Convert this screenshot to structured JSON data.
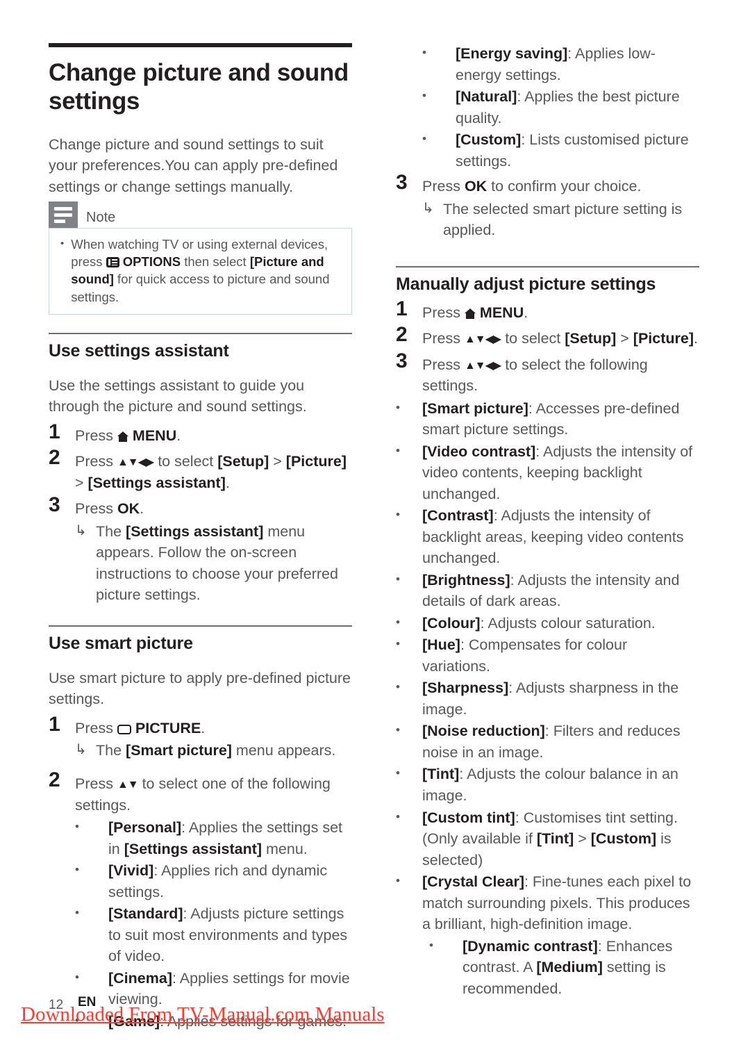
{
  "document": {
    "title": "Change picture and sound settings",
    "intro": "Change picture and sound settings to suit your preferences.You can apply pre-defined settings or change settings manually."
  },
  "note": {
    "label": "Note",
    "icon": "note-lines-icon",
    "bullet_char": "•",
    "items": [
      {
        "pre": "When watching TV or using external devices, press ",
        "icon": "options-icon",
        "key": "OPTIONS",
        "mid": " then select ",
        "bold": "[Picture and sound]",
        "post": " for quick access to picture and sound settings."
      }
    ]
  },
  "sections": {
    "settings_assistant": {
      "heading": "Use settings assistant",
      "intro": "Use the settings assistant to guide you through the picture and sound settings.",
      "steps": [
        {
          "num": "1",
          "pre": "Press ",
          "icon": "home-icon",
          "key": "MENU",
          "post": "."
        },
        {
          "num": "2",
          "pre": "Press ",
          "arrows": "▲▼◀▶",
          "mid": " to select ",
          "bold1": "[Setup]",
          "sep": " > ",
          "bold2": "[Picture]",
          "sep2": " > ",
          "bold3": "[Settings assistant]",
          "post": "."
        },
        {
          "num": "3",
          "pre": "Press ",
          "key": "OK",
          "post": "."
        }
      ],
      "result": {
        "arrow": "↳",
        "pre": "The ",
        "bold": "[Settings assistant]",
        "post": " menu appears. Follow the on-screen instructions to choose your preferred picture settings."
      }
    },
    "smart_picture": {
      "heading": "Use smart picture",
      "intro": "Use smart picture to apply pre-defined picture settings.",
      "step1": {
        "num": "1",
        "pre": "Press ",
        "icon": "picture-icon",
        "key": "PICTURE",
        "post": "."
      },
      "step1_result": {
        "arrow": "↳",
        "pre": "The ",
        "bold": "[Smart picture]",
        "post": " menu appears."
      },
      "step2": {
        "num": "2",
        "pre": "Press ",
        "arrows": "▲▼",
        "post": " to select one of the following settings."
      },
      "options": [
        {
          "bold": "[Personal]",
          "text": ": Applies the settings set in ",
          "bold2": "[Settings assistant]",
          "text2": " menu."
        },
        {
          "bold": "[Vivid]",
          "text": ": Applies rich and dynamic settings."
        },
        {
          "bold": "[Standard]",
          "text": ": Adjusts picture settings to suit most environments and types of video."
        },
        {
          "bold": "[Cinema]",
          "text": ": Applies settings for movie viewing."
        },
        {
          "bold": "[Game]",
          "text": ": Applies settings for games."
        },
        {
          "bold": "[Energy saving]",
          "text": ": Applies low-energy settings."
        },
        {
          "bold": "[Natural]",
          "text": ": Applies the best picture quality."
        },
        {
          "bold": "[Custom]",
          "text": ": Lists customised picture settings."
        }
      ],
      "step3": {
        "num": "3",
        "pre": "Press ",
        "key": "OK",
        "post": " to confirm your choice."
      },
      "step3_result": {
        "arrow": "↳",
        "text": "The selected smart picture setting is applied."
      }
    },
    "manual_picture": {
      "heading": "Manually adjust picture settings",
      "steps": [
        {
          "num": "1",
          "pre": "Press ",
          "icon": "home-icon",
          "key": "MENU",
          "post": "."
        },
        {
          "num": "2",
          "pre": "Press ",
          "arrows": "▲▼◀▶",
          "mid": " to select ",
          "bold1": "[Setup]",
          "sep": " > ",
          "bold2": "[Picture]",
          "post": "."
        },
        {
          "num": "3",
          "pre": "Press ",
          "arrows": "▲▼◀▶",
          "post": " to select the following settings."
        }
      ],
      "options": [
        {
          "bold": "[Smart picture]",
          "text": ": Accesses pre-defined smart picture settings."
        },
        {
          "bold": "[Video contrast]",
          "text": ": Adjusts the intensity of video contents, keeping backlight unchanged."
        },
        {
          "bold": "[Contrast]",
          "text": ": Adjusts the intensity of backlight areas, keeping video contents unchanged."
        },
        {
          "bold": "[Brightness]",
          "text": ": Adjusts the intensity and details of dark areas."
        },
        {
          "bold": "[Colour]",
          "text": ": Adjusts colour saturation."
        },
        {
          "bold": "[Hue]",
          "text": ": Compensates for colour variations."
        },
        {
          "bold": "[Sharpness]",
          "text": ": Adjusts sharpness in the image."
        },
        {
          "bold": "[Noise reduction]",
          "text": ": Filters and reduces noise in an image."
        },
        {
          "bold": "[Tint]",
          "text": ": Adjusts the colour balance in an image."
        },
        {
          "bold": "[Custom tint]",
          "text": ": Customises tint setting. (Only available if ",
          "bold2": "[Tint]",
          "text2": " > ",
          "bold3": "[Custom]",
          "text3": " is selected)"
        },
        {
          "bold": "[Crystal Clear]",
          "text": ": Fine-tunes each pixel to match surrounding pixels. This produces a brilliant, high-definition image."
        }
      ],
      "sub_option": {
        "bold": "[Dynamic contrast]",
        "text": ": Enhances contrast. A ",
        "bold2": "[Medium]",
        "text2": " setting is recommended."
      }
    }
  },
  "footer": {
    "page_number": "12",
    "language": "EN",
    "watermark": "Downloaded From TV-Manual.com Manuals",
    "watermark_color": "#fe3b30"
  },
  "bullet_char": "•",
  "arrow_char": "↳"
}
